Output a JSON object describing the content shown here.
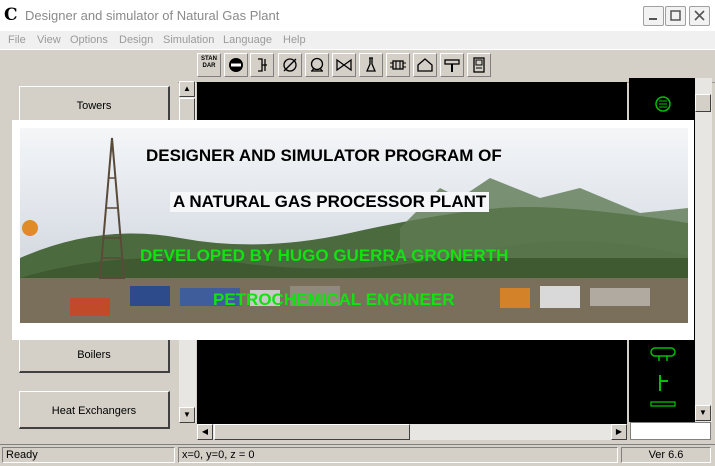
{
  "window": {
    "title": "Designer and simulator of Natural Gas Plant",
    "app_icon_glyph": "C"
  },
  "menu": [
    "File",
    "View",
    "Options",
    "Design",
    "Simulation",
    "Language",
    "Help"
  ],
  "toolbar": {
    "buttons": [
      {
        "name": "standard",
        "label": "STAN DAR"
      },
      {
        "name": "no-entry-icon"
      },
      {
        "name": "vessel-bracket-icon"
      },
      {
        "name": "diameter-icon"
      },
      {
        "name": "pump-icon"
      },
      {
        "name": "valve-icon"
      },
      {
        "name": "flask-icon"
      },
      {
        "name": "heat-exchanger-icon"
      },
      {
        "name": "house-icon"
      },
      {
        "name": "hammer-icon"
      },
      {
        "name": "panel-icon"
      }
    ]
  },
  "categories": [
    "Towers",
    "Boilers",
    "Heat Exchangers"
  ],
  "splash": {
    "line1": "DESIGNER AND SIMULATOR PROGRAM OF",
    "line2": "A NATURAL GAS PROCESSOR PLANT",
    "line3": "DEVELOPED BY HUGO GUERRA GRONERTH",
    "line4": "PETROCHEMICAL ENGINEER"
  },
  "status": {
    "state": "Ready",
    "coords": "x=0, y=0, z = 0",
    "version": "Ver 6.6"
  },
  "colors": {
    "palette_green": "#00c000",
    "title_gray": "#8a8a8a",
    "banner_green": "#11e311",
    "text_black": "#000000"
  }
}
